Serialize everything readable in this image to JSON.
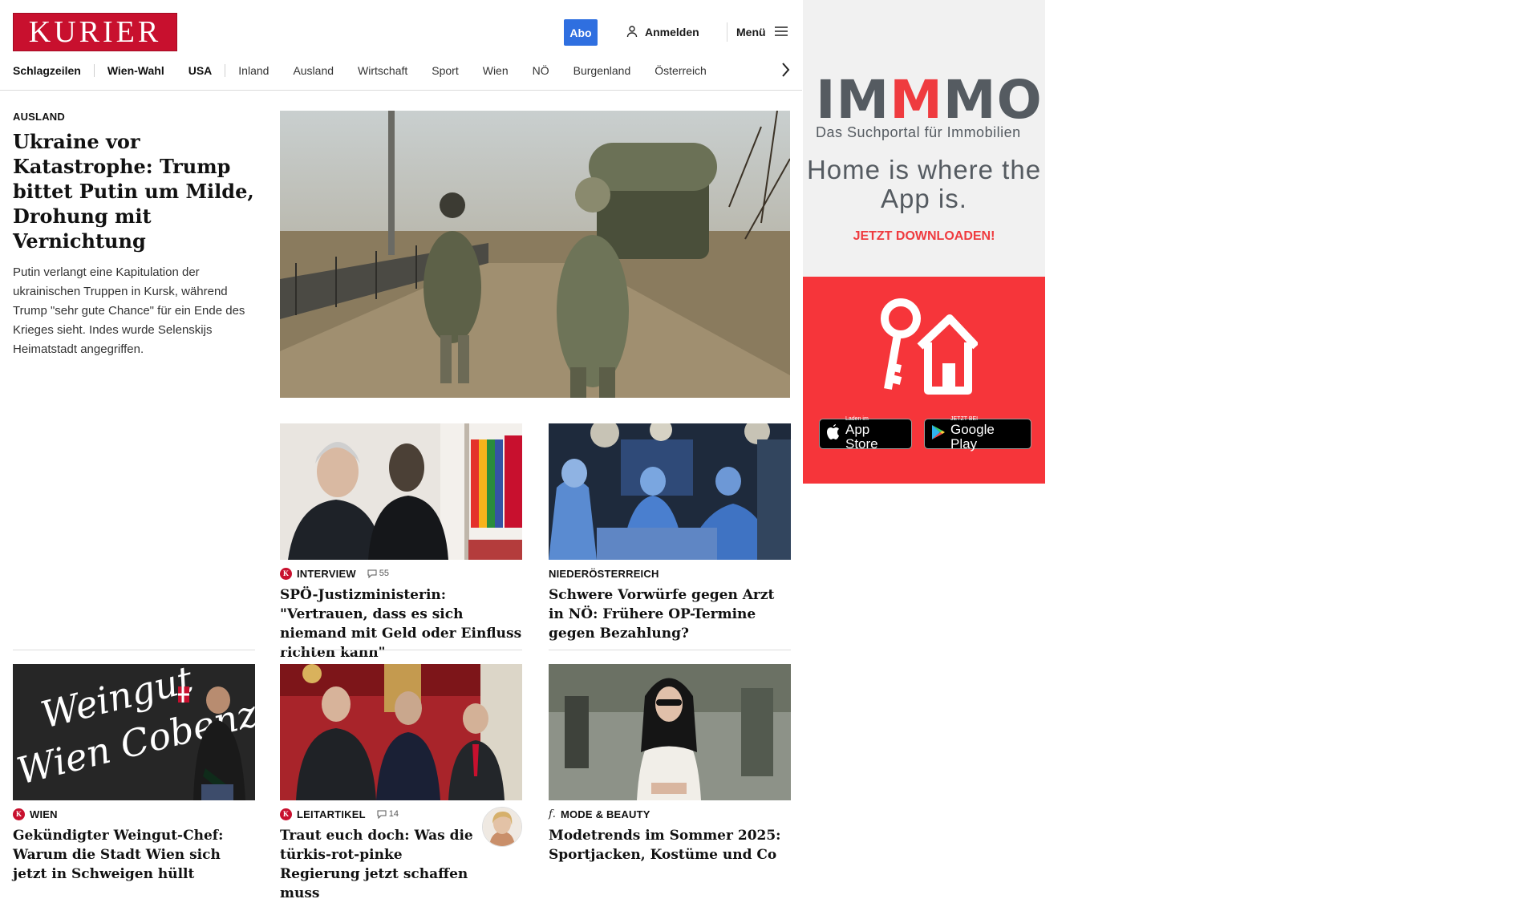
{
  "header": {
    "logo": "KURIER",
    "abo_label": "Abo",
    "login_label": "Anmelden",
    "menu_label": "Menü"
  },
  "nav": {
    "items": [
      "Schlagzeilen",
      "Wien-Wahl",
      "USA",
      "Inland",
      "Ausland",
      "Wirtschaft",
      "Sport",
      "Wien",
      "NÖ",
      "Burgenland",
      "Österreich"
    ]
  },
  "lead": {
    "kicker": "AUSLAND",
    "headline": "Ukraine vor Katastrophe: Trump bittet Putin um Milde, Drohung mit Vernichtung",
    "teaser": "Putin verlangt eine Kapitulation der ukrainischen Truppen in Kursk, während Trump \"sehr gute Chance\" für ein Ende des Krieges sieht. Indes wurde Selenskijs Heimatstadt angegriffen."
  },
  "cards": [
    {
      "kicker": "INTERVIEW",
      "premium": true,
      "comments": "55",
      "headline": "SPÖ-Justizministerin: \"Vertrauen, dass es sich niemand mit Geld oder Einfluss richten kann\""
    },
    {
      "kicker": "NIEDERÖSTERREICH",
      "premium": false,
      "comments": "",
      "headline": "Schwere Vorwürfe gegen Arzt in NÖ: Frühere OP-Termine gegen Bezahlung?"
    },
    {
      "kicker": "WIEN",
      "premium": true,
      "comments": "",
      "headline": "Gekündigter Weingut-Chef: Warum die Stadt Wien sich jetzt in Schweigen hüllt",
      "image_text": [
        "Weingut",
        "Wien Cobenzl"
      ]
    },
    {
      "kicker": "LEITARTIKEL",
      "premium": true,
      "comments": "14",
      "headline": "Traut euch doch: Was die türkis-rot-pinke Regierung jetzt schaffen muss"
    },
    {
      "kicker": "MODE & BEAUTY",
      "premium": false,
      "comments": "",
      "headline": "Modetrends im Sommer 2025: Sportjacken, Kostüme und Co"
    }
  ],
  "ad": {
    "brand_parts": [
      "IM",
      "M",
      "MO"
    ],
    "subtitle": "Das Suchportal für Immobilien",
    "claim": "Home is where the App is.",
    "cta": "JETZT DOWNLOADEN!",
    "appstore_small": "Laden im",
    "appstore_big": "App Store",
    "googleplay_small": "JETZT BEI",
    "googleplay_big": "Google Play"
  },
  "colors": {
    "brand_red": "#c8102e",
    "abo_blue": "#2f6fe0",
    "ad_red": "#f6353a",
    "ad_grey": "#555b61"
  }
}
